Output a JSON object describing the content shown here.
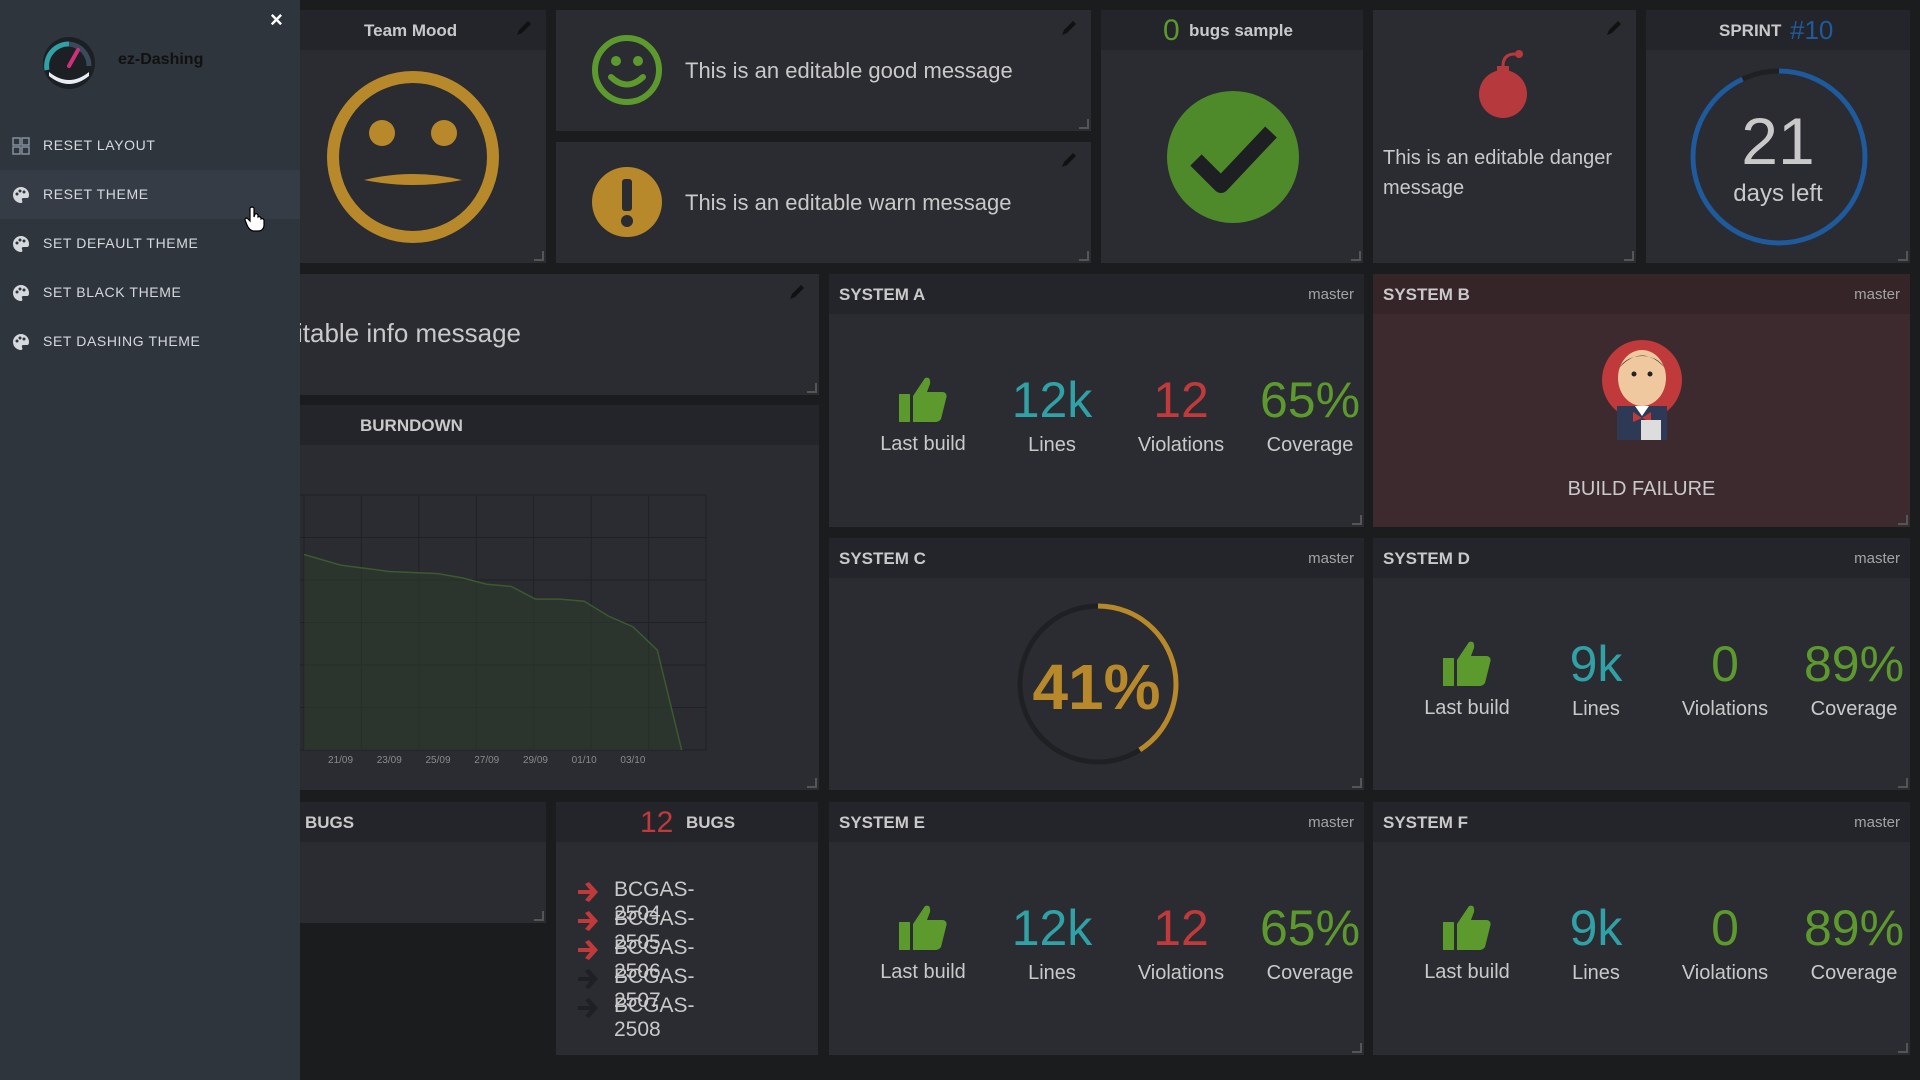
{
  "sidebar": {
    "app_name": "ez-Dashing",
    "close_glyph": "×",
    "items": [
      {
        "label": "RESET LAYOUT",
        "icon": "layout-grid-icon"
      },
      {
        "label": "RESET THEME",
        "icon": "palette-icon"
      },
      {
        "label": "SET DEFAULT THEME",
        "icon": "palette-icon"
      },
      {
        "label": "SET BLACK THEME",
        "icon": "palette-icon"
      },
      {
        "label": "SET DASHING THEME",
        "icon": "palette-icon"
      }
    ]
  },
  "team_mood": {
    "title": "Team Mood",
    "icon": "neutral-face-icon",
    "color": "#b8892b"
  },
  "good_message": {
    "text": "This is an editable good message",
    "icon": "smiley-icon",
    "color": "#5d9a2e"
  },
  "warn_message": {
    "text": "This is an editable warn message",
    "icon": "exclamation-icon",
    "color": "#b8892b"
  },
  "bugs_sample": {
    "count": "0",
    "title": "bugs sample",
    "icon": "check-circle-icon",
    "color": "#4e8a2a"
  },
  "danger_message": {
    "text": "This is an editable danger message",
    "icon": "bomb-icon",
    "color": "#b63a3d"
  },
  "sprint": {
    "label": "SPRINT",
    "number": "#10",
    "days": "21",
    "days_label": "days left",
    "progress": 0.93
  },
  "info_message": {
    "text": "itable info message"
  },
  "burndown": {
    "title": "BURNDOWN"
  },
  "chart_data": {
    "type": "area",
    "title": "BURNDOWN",
    "x": [
      "21/09",
      "23/09",
      "25/09",
      "27/09",
      "29/09",
      "01/10",
      "03/10"
    ],
    "tick_labels": [
      "21/09",
      "23/09",
      "25/09",
      "27/09",
      "29/09",
      "01/10",
      "03/10"
    ],
    "series": [
      {
        "points": [
          [
            19.5,
            92
          ],
          [
            21,
            87
          ],
          [
            23,
            84
          ],
          [
            25,
            83
          ],
          [
            26,
            81
          ],
          [
            27,
            78
          ],
          [
            28,
            77
          ],
          [
            29,
            71
          ],
          [
            30,
            71
          ],
          [
            31,
            70
          ],
          [
            32,
            63
          ],
          [
            33,
            58
          ],
          [
            34,
            47
          ],
          [
            35,
            0
          ]
        ]
      }
    ],
    "ylim": [
      0,
      120
    ],
    "grid": true
  },
  "bugs_left": {
    "title": "BUGS"
  },
  "bugs_list": {
    "count": "12",
    "title": "BUGS",
    "items": [
      {
        "id": "BCGAS-2504",
        "color": "#c0393b"
      },
      {
        "id": "BCGAS-2505",
        "color": "#c0393b"
      },
      {
        "id": "BCGAS-2506",
        "color": "#c0393b"
      },
      {
        "id": "BCGAS-2507",
        "color": "#1f2024"
      },
      {
        "id": "BCGAS-2508",
        "color": "#1f2024"
      }
    ]
  },
  "systems": {
    "a": {
      "name": "SYSTEM A",
      "branch": "master",
      "lines": "12k",
      "violations": "12",
      "coverage": "65%",
      "last_build": "Last build",
      "lines_label": "Lines",
      "violations_label": "Violations",
      "coverage_label": "Coverage"
    },
    "b": {
      "name": "SYSTEM B",
      "branch": "master",
      "status": "BUILD FAILURE",
      "icon": "jenkins-butler-icon"
    },
    "c": {
      "name": "SYSTEM C",
      "branch": "master",
      "percent": "41%",
      "progress": 0.41
    },
    "d": {
      "name": "SYSTEM D",
      "branch": "master",
      "lines": "9k",
      "violations": "0",
      "coverage": "89%",
      "last_build": "Last build",
      "lines_label": "Lines",
      "violations_label": "Violations",
      "coverage_label": "Coverage"
    },
    "e": {
      "name": "SYSTEM E",
      "branch": "master",
      "lines": "12k",
      "violations": "12",
      "coverage": "65%",
      "last_build": "Last build",
      "lines_label": "Lines",
      "violations_label": "Violations",
      "coverage_label": "Coverage"
    },
    "f": {
      "name": "SYSTEM F",
      "branch": "master",
      "lines": "9k",
      "violations": "0",
      "coverage": "89%",
      "last_build": "Last build",
      "lines_label": "Lines",
      "violations_label": "Violations",
      "coverage_label": "Coverage"
    }
  },
  "colors": {
    "teal": "#2fa1a7",
    "red": "#c0393b",
    "green": "#5d9a2e",
    "gold": "#b8892b",
    "blue": "#1f5a9c",
    "failure_bg": "#3d2a2e"
  }
}
